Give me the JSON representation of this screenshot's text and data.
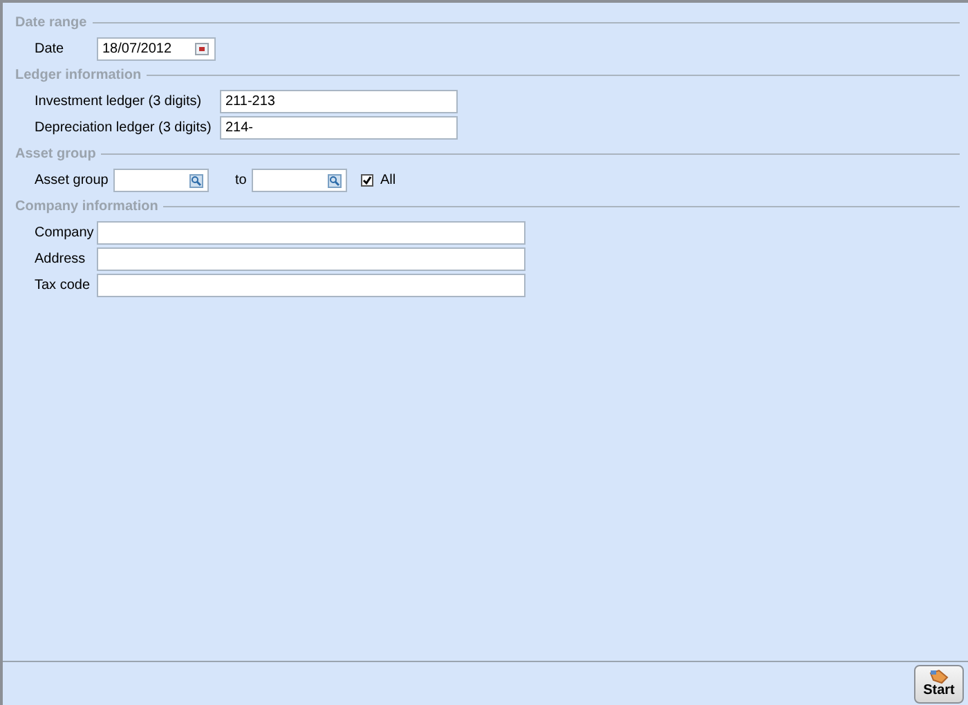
{
  "date_range": {
    "title": "Date range",
    "date": {
      "label": "Date",
      "value": "18/07/2012"
    }
  },
  "ledger_information": {
    "title": "Ledger information",
    "fields": [
      {
        "label": "Investment ledger (3 digits)",
        "value": "211-213"
      },
      {
        "label": "Depreciation ledger (3 digits)",
        "value": "214-"
      }
    ]
  },
  "asset_group": {
    "title": "Asset group",
    "label": "Asset group",
    "to_label": "to",
    "all": {
      "label": "All",
      "checked": true
    }
  },
  "company_information": {
    "title": "Company information",
    "fields": [
      {
        "label": "Company"
      },
      {
        "label": "Address"
      },
      {
        "label": "Tax code"
      }
    ]
  },
  "start_button": {
    "label": "Start"
  }
}
